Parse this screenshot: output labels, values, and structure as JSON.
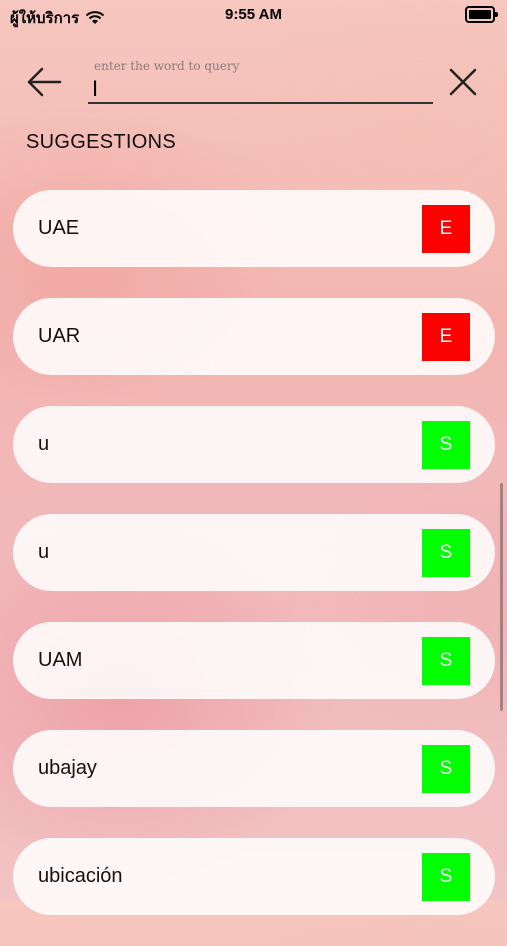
{
  "status": {
    "carrier": "ผู้ให้บริการ",
    "time": "9:55 AM"
  },
  "search": {
    "placeholder": "enter the word to query",
    "value": "I"
  },
  "section_title": "SUGGESTIONS",
  "suggestions": [
    {
      "word": "UAE",
      "tag": "E"
    },
    {
      "word": "UAR",
      "tag": "E"
    },
    {
      "word": "u",
      "tag": "S"
    },
    {
      "word": "u",
      "tag": "S"
    },
    {
      "word": "UAM",
      "tag": "S"
    },
    {
      "word": "ubajay",
      "tag": "S"
    },
    {
      "word": "ubicación",
      "tag": "S"
    }
  ],
  "colors": {
    "tag_E": "#ff0000",
    "tag_S": "#00ff00"
  },
  "icons": {
    "back": "arrow-left-icon",
    "close": "close-icon",
    "wifi": "wifi-icon",
    "battery": "battery-icon"
  }
}
